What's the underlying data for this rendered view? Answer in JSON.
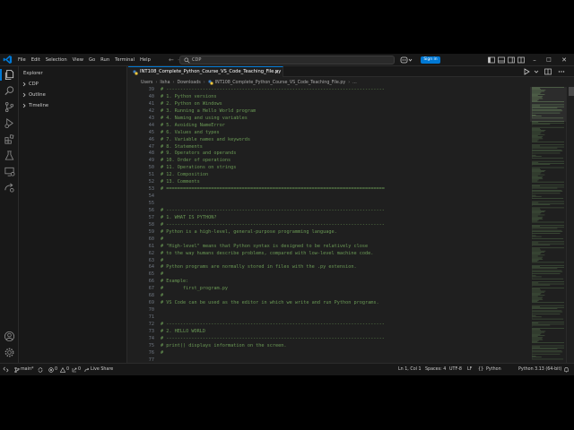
{
  "titlebar": {
    "menu": [
      "File",
      "Edit",
      "Selection",
      "View",
      "Go",
      "Run",
      "Terminal",
      "Help"
    ],
    "search_text": "CDP",
    "signin_label": "Sign in"
  },
  "sidebar": {
    "header": "Explorer",
    "sections": [
      "CDP",
      "Outline",
      "Timeline"
    ]
  },
  "tab": {
    "title": "INT108_Complete_Python_Course_VS_Code_Teaching_File.py"
  },
  "breadcrumb": [
    "Users",
    "lisha",
    "Downloads",
    "INT108_Complete_Python_Course_VS_Code_Teaching_File.py",
    "..."
  ],
  "code": {
    "line_numbers": [
      "39",
      "40",
      "41",
      "42",
      "43",
      "44",
      "45",
      "46",
      "47",
      "48",
      "49",
      "50",
      "51",
      "52",
      "53",
      "54",
      "55",
      "56",
      "57",
      "58",
      "59",
      "60",
      "61",
      "62",
      "63",
      "64",
      "65",
      "66",
      "67",
      "68",
      "69",
      "70",
      "71",
      "72",
      "73",
      "74",
      "75",
      "76",
      "77"
    ],
    "lines": [
      "# ------------------------------------------------------------------------------",
      "# 1. Python versions",
      "# 2. Python on Windows",
      "# 3. Running a Hello World program",
      "# 4. Naming and using variables",
      "# 5. Avoiding NameError",
      "# 6. Values and types",
      "# 7. Variable names and keywords",
      "# 8. Statements",
      "# 9. Operators and operands",
      "# 10. Order of operations",
      "# 11. Operations on strings",
      "# 12. Composition",
      "# 13. Comments",
      "# ==============================================================================",
      "",
      "",
      "# ------------------------------------------------------------------------------",
      "# 1. WHAT IS PYTHON?",
      "# ------------------------------------------------------------------------------",
      "# Python is a high-level, general-purpose programming language.",
      "#",
      "# \"High-level\" means that Python syntax is designed to be relatively close",
      "# to the way humans describe problems, compared with low-level machine code.",
      "#",
      "# Python programs are normally stored in files with the .py extension.",
      "#",
      "# Example:",
      "#       first_program.py",
      "#",
      "# VS Code can be used as the editor in which we write and run Python programs.",
      "",
      "",
      "# ------------------------------------------------------------------------------",
      "# 2. HELLO WORLD",
      "# ------------------------------------------------------------------------------",
      "# print() displays information on the screen.",
      "#",
      ""
    ]
  },
  "status": {
    "branch": "main*",
    "errors": "0",
    "warnings": "0",
    "ports": "0",
    "live_share": "Live Share",
    "position": "Ln 1, Col 1",
    "spaces": "Spaces: 4",
    "encoding": "UTF-8",
    "eol": "LF",
    "language": "Python",
    "interpreter": "Python 3.13 (64-bit)"
  },
  "colors": {
    "accent": "#0078d4",
    "comment": "#6a9955",
    "background": "#1f1f1f",
    "chrome": "#181818"
  },
  "icons": [
    "vscode-logo-icon",
    "explorer-icon",
    "search-icon",
    "source-control-icon",
    "run-debug-icon",
    "extensions-icon",
    "testing-icon",
    "remote-explorer-icon",
    "live-share-icon",
    "account-icon",
    "manage-gear-icon",
    "split-editor-icon",
    "more-actions-icon",
    "bell-icon"
  ]
}
